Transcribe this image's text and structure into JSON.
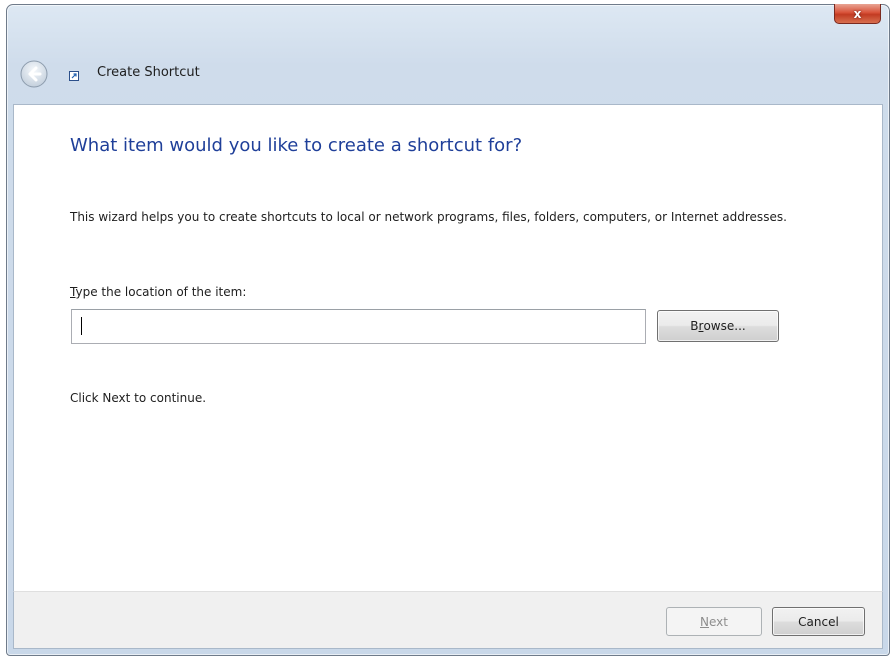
{
  "window": {
    "title": "Create Shortcut",
    "close_label": "x"
  },
  "wizard": {
    "heading": "What item would you like to create a shortcut for?",
    "description": "This wizard helps you to create shortcuts to local or network programs, files, folders, computers, or Internet addresses.",
    "location_label_prefix": "T",
    "location_label_rest": "ype the location of the item:",
    "location_value": "",
    "browse_prefix": "B",
    "browse_accel": "r",
    "browse_rest": "owse...",
    "continue_text": "Click Next to continue."
  },
  "footer": {
    "next_accel": "N",
    "next_rest": "ext",
    "next_disabled": true,
    "cancel_label": "Cancel"
  },
  "icons": {
    "back": "back-arrow-icon",
    "shortcut": "shortcut-icon",
    "close": "close-icon"
  },
  "colors": {
    "heading": "#1f3f99",
    "frame": "#cfdceb",
    "close_button": "#c23b22",
    "footer": "#f0f0f0"
  }
}
